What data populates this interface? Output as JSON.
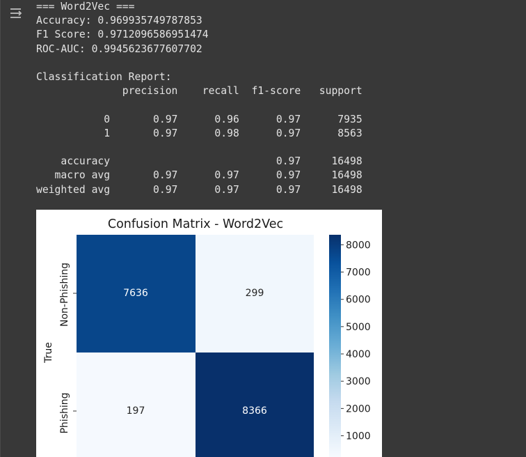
{
  "output": {
    "icon": "output-toggle-icon",
    "lines": [
      "=== Word2Vec ===",
      "Accuracy: 0.969935749787853",
      "F1 Score: 0.9712096586951474",
      "ROC-AUC: 0.9945623677607702",
      "",
      "Classification Report:",
      "              precision    recall  f1-score   support",
      "",
      "           0       0.97      0.96      0.97      7935",
      "           1       0.97      0.98      0.97      8563",
      "",
      "    accuracy                           0.97     16498",
      "   macro avg       0.97      0.97      0.97     16498",
      "weighted avg       0.97      0.97      0.97     16498"
    ]
  },
  "chart_data": {
    "type": "heatmap",
    "title": "Confusion Matrix - Word2Vec",
    "ylabel": "True",
    "row_labels": [
      "Non-Phishing",
      "Phishing"
    ],
    "matrix": [
      [
        7636,
        299
      ],
      [
        197,
        8366
      ]
    ],
    "colormap": "Blues",
    "colorbar": {
      "range": [
        197,
        8366
      ],
      "ticks": [
        1000,
        2000,
        3000,
        4000,
        5000,
        6000,
        7000,
        8000
      ]
    }
  },
  "colors": {
    "background": "#383838",
    "text": "#e3e3e3",
    "cell_high": "#08306b",
    "cell_mid_high": "#08468a",
    "cell_low": "#f7fbff"
  }
}
